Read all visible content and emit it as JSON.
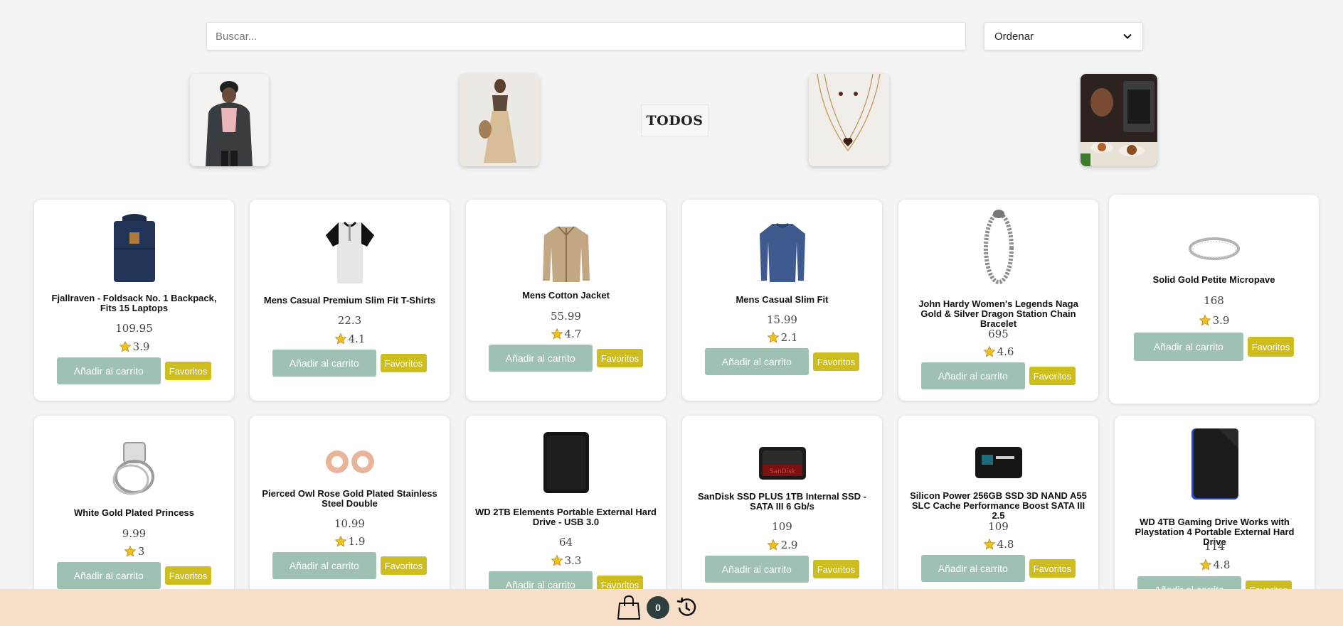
{
  "search": {
    "placeholder": "Buscar..."
  },
  "sort": {
    "selected": "Ordenar"
  },
  "categories": {
    "todos_label": "TODOS"
  },
  "products": [
    {
      "title": "Fjallraven - Foldsack No. 1 Backpack, Fits 15 Laptops",
      "price": "109.95",
      "rating": "3.9"
    },
    {
      "title": "Mens Casual Premium Slim Fit T-Shirts",
      "price": "22.3",
      "rating": "4.1"
    },
    {
      "title": "Mens Cotton Jacket",
      "price": "55.99",
      "rating": "4.7"
    },
    {
      "title": "Mens Casual Slim Fit",
      "price": "15.99",
      "rating": "2.1"
    },
    {
      "title": "John Hardy Women's Legends Naga Gold & Silver Dragon Station Chain Bracelet",
      "price": "695",
      "rating": "4.6"
    },
    {
      "title": "Solid Gold Petite Micropave",
      "price": "168",
      "rating": "3.9"
    },
    {
      "title": "White Gold Plated Princess",
      "price": "9.99",
      "rating": "3"
    },
    {
      "title": "Pierced Owl Rose Gold Plated Stainless Steel Double",
      "price": "10.99",
      "rating": "1.9"
    },
    {
      "title": "WD 2TB Elements Portable External Hard Drive - USB 3.0",
      "price": "64",
      "rating": "3.3"
    },
    {
      "title": "SanDisk SSD PLUS 1TB Internal SSD - SATA III 6 Gb/s",
      "price": "109",
      "rating": "2.9"
    },
    {
      "title": "Silicon Power 256GB SSD 3D NAND A55 SLC Cache Performance Boost SATA III 2.5",
      "price": "109",
      "rating": "4.8"
    },
    {
      "title": "WD 4TB Gaming Drive Works with Playstation 4 Portable External Hard Drive",
      "price": "114",
      "rating": "4.8"
    }
  ],
  "buttons": {
    "add_to_cart": "Añadir al carrito",
    "favorites": "Favoritos"
  },
  "cart": {
    "count": "0"
  },
  "colors": {
    "cart_button": "#9fc1b4",
    "fav_button": "#cdbd1f",
    "bottom_bar": "#f6dec8",
    "badge": "#2e3e3f"
  },
  "icons": {
    "cart": "shopping-bag-icon",
    "history": "history-icon",
    "star": "star-icon",
    "sort": "chevron-down-icon"
  }
}
